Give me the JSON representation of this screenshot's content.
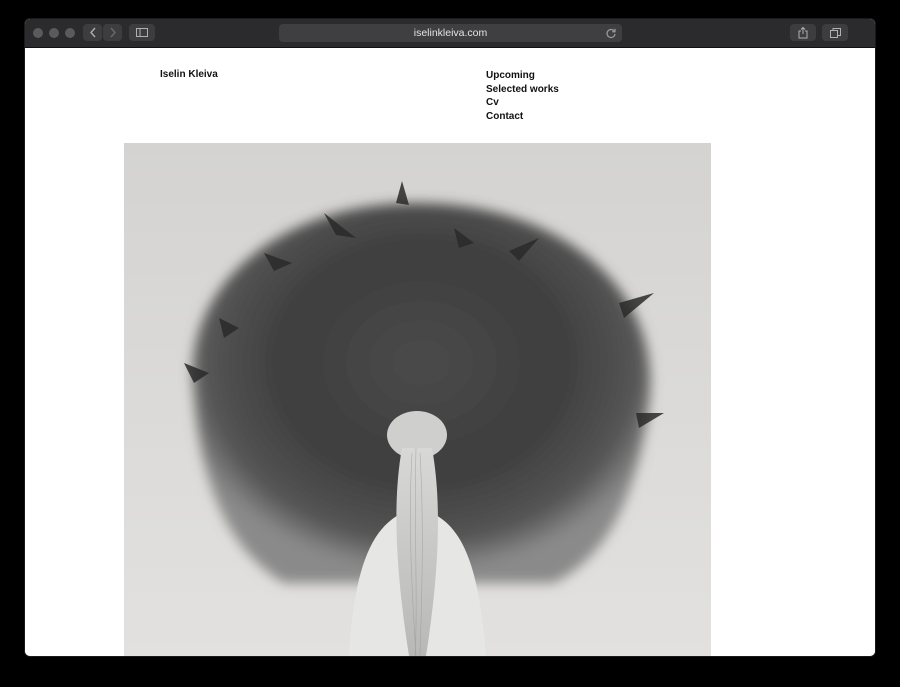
{
  "browser": {
    "url": "iselinkleiva.com",
    "icons": {
      "back": "chevron-left-icon",
      "forward": "chevron-right-icon",
      "sidebar": "sidebar-icon",
      "reload": "reload-icon",
      "share": "share-icon",
      "tabs": "tabs-overview-icon"
    }
  },
  "site": {
    "title": "Iselin Kleiva",
    "nav": [
      {
        "label": "Upcoming"
      },
      {
        "label": "Selected works"
      },
      {
        "label": "Cv"
      },
      {
        "label": "Contact"
      }
    ]
  },
  "colors": {
    "chrome": "#2b2b2d",
    "page_bg": "#ffffff",
    "text": "#111111"
  }
}
